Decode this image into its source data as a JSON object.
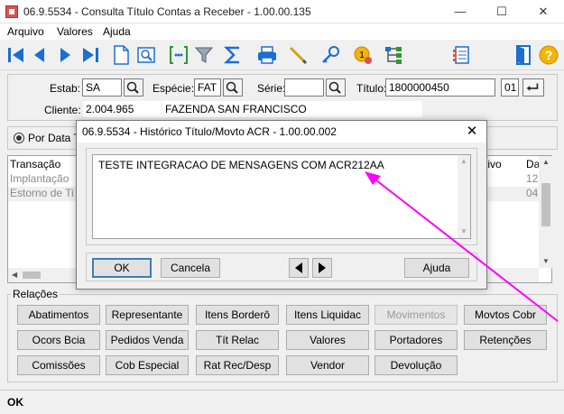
{
  "window": {
    "title": "06.9.5534 - Consulta Título Contas a Receber - 1.00.00.135",
    "minimize": "—",
    "maximize": "☐",
    "close": "✕"
  },
  "menu": [
    "Arquivo",
    "Valores",
    "Ajuda"
  ],
  "toolbar_icons": [
    "first-icon",
    "prev-icon",
    "next-icon",
    "last-icon",
    "new-document-icon",
    "preview-icon",
    "goto-icon",
    "filter-icon",
    "sum-icon",
    "print-icon",
    "edit-icon",
    "search-key-icon",
    "info-icon",
    "tree-icon",
    "list-icon",
    "exit-icon",
    "help-icon"
  ],
  "filter": {
    "estab_label": "Estab:",
    "estab_value": "SA",
    "especie_label": "Espécie:",
    "especie_value": "FAT",
    "serie_label": "Série:",
    "serie_value": "",
    "titulo_label": "Título:",
    "titulo_value": "1800000450",
    "parcela_value": "01",
    "cliente_label": "Cliente:",
    "cliente_code": "2.004.965",
    "cliente_name": "FAZENDA SAN FRANCISCO"
  },
  "radio": {
    "label": "Por Data T"
  },
  "grid": {
    "headers": [
      "Transação",
      "tivo",
      "Da"
    ],
    "rows": [
      {
        "transacao": "Implantação",
        "da": "12"
      },
      {
        "transacao": "Estorno de Ti",
        "da": "04"
      }
    ]
  },
  "relacoes": {
    "title": "Relações",
    "buttons": [
      [
        "Abatimentos",
        "Representante",
        "Itens Borderô",
        "Itens Liquidac",
        "Movimentos",
        "Movtos Cobr"
      ],
      [
        "Ocors Bcia",
        "Pedidos Venda",
        "Tít  Relac",
        "Valores",
        "Portadores",
        "Retenções"
      ],
      [
        "Comissões",
        "Cob Especial",
        "Rat Rec/Desp",
        "Vendor",
        "Devolução"
      ]
    ],
    "disabled": [
      "Movimentos"
    ]
  },
  "status": {
    "text": "OK"
  },
  "dialog": {
    "title": "06.9.5534 - Histórico Título/Movto ACR - 1.00.00.002",
    "close": "✕",
    "text": "TESTE INTEGRACAO DE MENSAGENS COM ACR212AA",
    "ok_label": "OK",
    "cancel_label": "Cancela",
    "help_label": "Ajuda"
  },
  "colors": {
    "annotation_arrow": "#ff00ff",
    "toolbar_blue": "#1a6fd0"
  }
}
